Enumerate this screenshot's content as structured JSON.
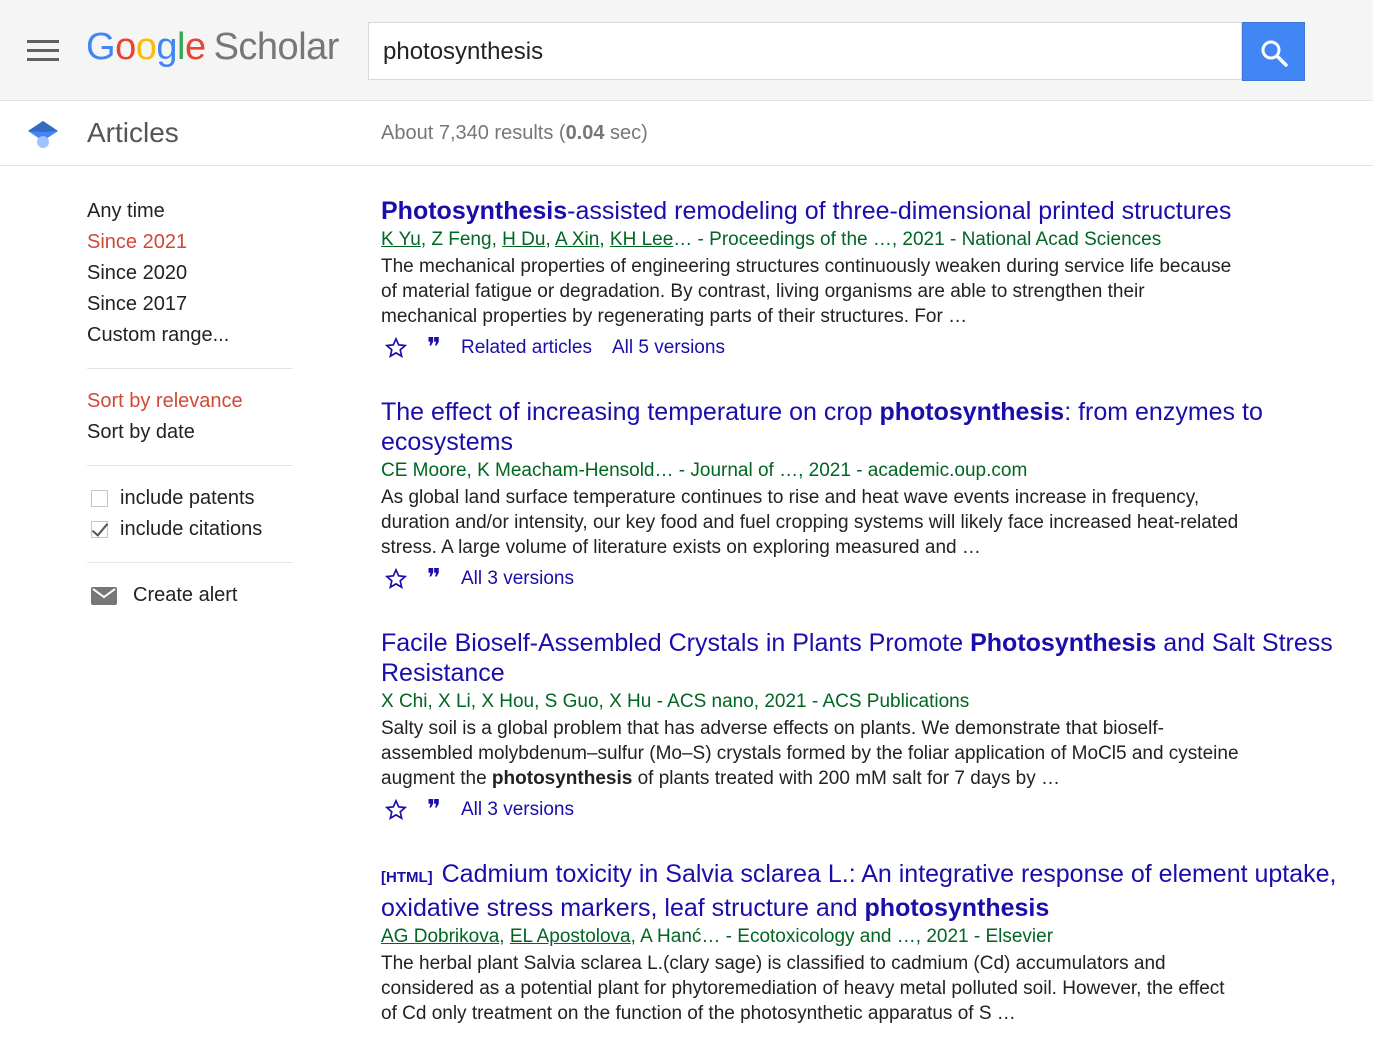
{
  "header": {
    "logo": {
      "g1": "G",
      "o1": "o",
      "o2": "o",
      "g2": "g",
      "l": "l",
      "e": "e",
      "scholar": "Scholar"
    },
    "search_value": "photosynthesis",
    "colors": {
      "blue": "#4285f4",
      "red": "#ea4335",
      "yellow": "#fbbc05",
      "green": "#34a853"
    }
  },
  "subheader": {
    "section": "Articles",
    "results_prefix": "About 7,340 results (",
    "results_time": "0.04",
    "results_suffix": " sec)"
  },
  "sidebar": {
    "time_filters": [
      "Any time",
      "Since 2021",
      "Since 2020",
      "Since 2017",
      "Custom range..."
    ],
    "sort": [
      "Sort by relevance",
      "Sort by date"
    ],
    "include_patents": "include patents",
    "include_citations": "include citations",
    "create_alert": "Create alert",
    "active_color": "#d14836"
  },
  "results": [
    {
      "title_bold": "Photosynthesis",
      "title_rest": "-assisted remodeling of three-dimensional printed structures",
      "authors": [
        "K Yu",
        "Z Feng",
        "H Du",
        "A Xin",
        "KH Lee"
      ],
      "authors_tail": "… - Proceedings of the …, 2021 - National Acad Sciences",
      "snippet": "The mechanical properties of engineering structures continuously weaken during service life because of material fatigue or degradation. By contrast, living organisms are able to strengthen their mechanical properties by regenerating parts of their structures. For …",
      "actions": [
        "Related articles",
        "All 5 versions"
      ]
    },
    {
      "title_pre": "The effect of increasing temperature on crop ",
      "title_bold": "photosynthesis",
      "title_post": ": from enzymes to ecosystems",
      "authors_text": "CE Moore, K Meacham-Hensold… - Journal of …, 2021 - academic.oup.com",
      "snippet": "As global land surface temperature continues to rise and heat wave events increase in frequency, duration and/or intensity, our key food and fuel cropping systems will likely face increased heat-related stress. A large volume of literature exists on exploring measured and …",
      "actions": [
        "All 3 versions"
      ]
    },
    {
      "title_pre": "Facile Bioself-Assembled Crystals in Plants Promote ",
      "title_bold": "Photosynthesis",
      "title_post": " and Salt Stress Resistance",
      "authors_text": "X Chi, X Li, X Hou, S Guo, X Hu - ACS nano, 2021 - ACS Publications",
      "snippet_pre": "Salty soil is a global problem that has adverse effects on plants. We demonstrate that bioself-assembled molybdenum–sulfur (Mo–S) crystals formed by the foliar application of MoCl5 and cysteine augment the ",
      "snippet_bold": "photosynthesis",
      "snippet_post": " of plants treated with 200 mM salt for 7 days by …",
      "actions": [
        "All 3 versions"
      ]
    },
    {
      "format_tag": "[HTML]",
      "title_pre": "Cadmium toxicity in Salvia sclarea L.: An integrative response of element uptake, oxidative stress markers, leaf structure and ",
      "title_bold": "photosynthesis",
      "authors": [
        "AG Dobrikova",
        "EL Apostolova"
      ],
      "authors_tail": ", A Hanć… - Ecotoxicology and …, 2021 - Elsevier",
      "snippet": "The herbal plant Salvia sclarea L.(clary sage) is classified to cadmium (Cd) accumulators and considered as a potential plant for phytoremediation of heavy metal polluted soil. However, the effect of Cd only treatment on the function of the photosynthetic apparatus of S …"
    }
  ],
  "icons": {
    "menu": "hamburger-menu-icon",
    "search": "search-icon",
    "section": "graduation-cap-icon",
    "star": "star-icon",
    "cite": "quote-icon",
    "mail": "mail-icon"
  }
}
